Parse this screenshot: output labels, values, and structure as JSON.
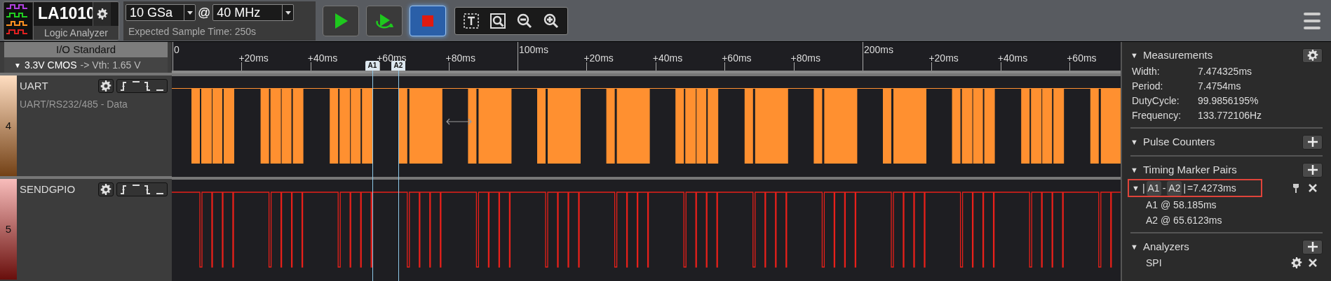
{
  "toolbar": {
    "device": "LA1010",
    "subtitle": "Logic Analyzer",
    "sample_depth": "10 GSa",
    "separator": "@",
    "sample_rate": "40 MHz",
    "expected_time": "Expected Sample Time: 250s"
  },
  "io_standard": {
    "title": "I/O Standard",
    "toggle": "▼",
    "value": "3.3V CMOS",
    "vth": "-> Vth: 1.65 V"
  },
  "ruler": {
    "ticks": [
      "0",
      "+20ms",
      "+40ms",
      "+60ms",
      "+80ms",
      "100ms",
      "+20ms",
      "+40ms",
      "+60ms",
      "+80ms",
      "200ms",
      "+20ms",
      "+40ms",
      "+60ms"
    ]
  },
  "markers": [
    {
      "label": "A1"
    },
    {
      "label": "A2"
    }
  ],
  "channels": [
    {
      "index": "4",
      "name": "UART",
      "protocol": "UART/RS232/485 - Data",
      "color": "#ff9030",
      "kind": "bus"
    },
    {
      "index": "5",
      "name": "SENDGPIO",
      "color": "#e8201a",
      "kind": "digital"
    }
  ],
  "side_panel": {
    "sections": [
      {
        "title": "Measurements",
        "toggle": "▼",
        "kind": "settings",
        "rows": [
          {
            "label": "Width:",
            "value": "7.474325ms"
          },
          {
            "label": "Period:",
            "value": "7.4754ms"
          },
          {
            "label": "DutyCycle:",
            "value": "99.9856195%"
          },
          {
            "label": "Frequency:",
            "value": "133.772106Hz"
          }
        ]
      },
      {
        "title": "Pulse Counters",
        "toggle": "▼",
        "kind": "add"
      },
      {
        "title": "Timing Marker Pairs",
        "toggle": "▼",
        "kind": "add",
        "pairs": [
          {
            "toggle": "▼",
            "bar_left": "|",
            "a": "A1",
            "dash": "-",
            "b": "A2",
            "bar_right": "|",
            "result": "=7.4273ms",
            "selected": true,
            "details": [
              "A1 @ 58.185ms",
              "A2 @ 65.6123ms"
            ]
          }
        ]
      },
      {
        "title": "Analyzers",
        "toggle": "▼",
        "kind": "add",
        "items": [
          {
            "name": "SPI"
          }
        ]
      }
    ]
  }
}
